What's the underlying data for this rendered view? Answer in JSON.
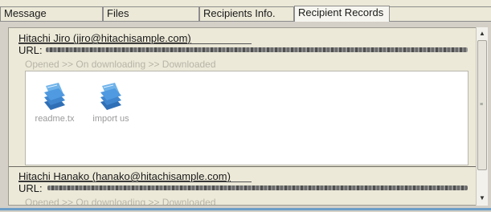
{
  "tabs": [
    {
      "label": "Message"
    },
    {
      "label": "Files"
    },
    {
      "label": "Recipients Info."
    },
    {
      "label": "Recipient Records",
      "active": true
    }
  ],
  "records": [
    {
      "name": "Hitachi Jiro (jiro@hitachisample.com)",
      "url_label": "URL:",
      "status": "Opened >> On downloading >> Downloaded",
      "files": [
        {
          "icon": "document-stack-icon",
          "label": "readme.tx"
        },
        {
          "icon": "document-stack-icon",
          "label": "import  us"
        }
      ]
    },
    {
      "name": "Hitachi Hanako (hanako@hitachisample.com)",
      "url_label": "URL:",
      "status": "Opened >> On downloading >> Downloaded"
    }
  ],
  "colors": {
    "accent_line": "#6d9ec7",
    "status_text": "#b7b4a8",
    "file_icon": "#3f86cf"
  }
}
